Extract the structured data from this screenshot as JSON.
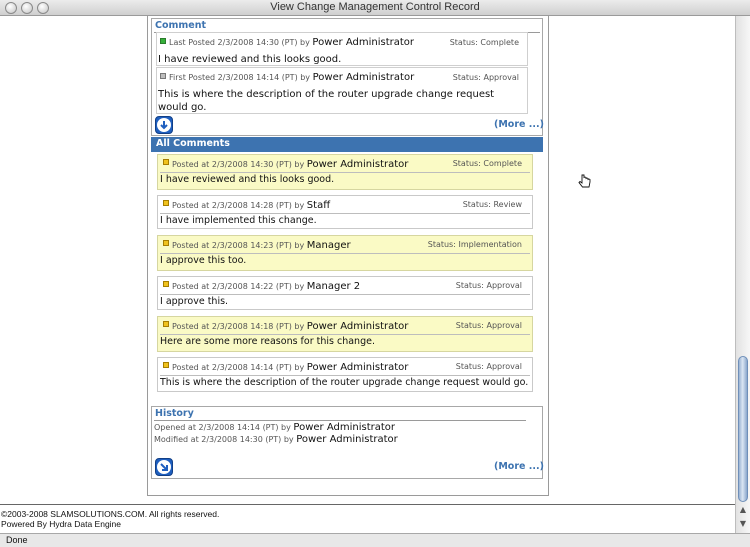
{
  "window": {
    "title": "View Change Management Control Record"
  },
  "status_bar": {
    "text": "Done"
  },
  "comment_box": {
    "title": "Comment",
    "entries": [
      {
        "indicator": "green",
        "meta": "Last Posted 2/3/2008 14:30 (PT) by",
        "author": "Power Administrator",
        "status": "Status: Complete",
        "text": "I have reviewed and this looks good."
      },
      {
        "indicator": "grey",
        "meta": "First Posted 2/3/2008 14:14 (PT) by",
        "author": "Power Administrator",
        "status": "Status: Approval",
        "text": "This is where the description of the router upgrade change request would go."
      }
    ],
    "more_label": "(More ...)",
    "action_icon": "down-arrow-icon"
  },
  "all_comments": {
    "title": "All Comments",
    "items": [
      {
        "meta": "Posted at 2/3/2008 14:30 (PT) by",
        "author": "Power Administrator",
        "status": "Status: Complete",
        "text": "I have reviewed and this looks good.",
        "highlight": true
      },
      {
        "meta": "Posted at 2/3/2008 14:28 (PT) by",
        "author": "Staff",
        "status": "Status: Review",
        "text": "I have implemented this change.",
        "highlight": false
      },
      {
        "meta": "Posted at 2/3/2008 14:23 (PT) by",
        "author": "Manager",
        "status": "Status: Implementation",
        "text": "I approve this too.",
        "highlight": true
      },
      {
        "meta": "Posted at 2/3/2008 14:22 (PT) by",
        "author": "Manager 2",
        "status": "Status: Approval",
        "text": "I approve this.",
        "highlight": false
      },
      {
        "meta": "Posted at 2/3/2008 14:18 (PT) by",
        "author": "Power Administrator",
        "status": "Status: Approval",
        "text": "Here are some more reasons for this change.",
        "highlight": true
      },
      {
        "meta": "Posted at 2/3/2008 14:14 (PT) by",
        "author": "Power Administrator",
        "status": "Status: Approval",
        "text": "This is where the description of the router upgrade change request would go.",
        "highlight": false
      }
    ]
  },
  "history": {
    "title": "History",
    "opened_meta": "Opened at 2/3/2008 14:14 (PT) by",
    "opened_by": "Power Administrator",
    "modified_meta": "Modified at 2/3/2008 14:30 (PT) by",
    "modified_by": "Power Administrator",
    "more_label": "(More ...)",
    "action_icon": "diagonal-arrow-icon"
  },
  "footer": {
    "copyright": "©2003-2008 SLAMSOLUTIONS.COM. All rights reserved.",
    "powered": "Powered By Hydra Data Engine"
  },
  "colors": {
    "accent": "#3d73b0",
    "highlight": "#fafac5",
    "green": "#36b03a",
    "yellow": "#f0c21d"
  }
}
